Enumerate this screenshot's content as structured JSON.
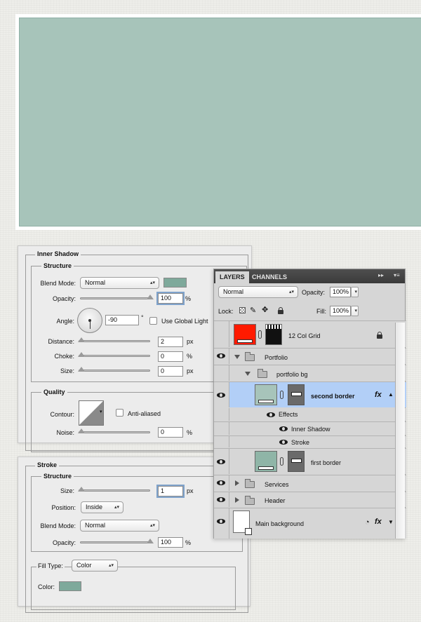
{
  "canvas": {
    "fill_color": "#a7c4ba"
  },
  "inner_shadow": {
    "title": "Inner Shadow",
    "structure_legend": "Structure",
    "blend_mode_label": "Blend Mode:",
    "blend_mode_value": "Normal",
    "color": "#7ea99b",
    "opacity_label": "Opacity:",
    "opacity_value": "100",
    "opacity_unit": "%",
    "angle_label": "Angle:",
    "angle_value": "-90",
    "degree_symbol": "°",
    "use_global_light_label": "Use Global Light",
    "distance_label": "Distance:",
    "distance_value": "2",
    "distance_unit": "px",
    "choke_label": "Choke:",
    "choke_value": "0",
    "choke_unit": "%",
    "size_label": "Size:",
    "size_value": "0",
    "size_unit": "px",
    "quality_legend": "Quality",
    "contour_label": "Contour:",
    "anti_aliased_label": "Anti-aliased",
    "noise_label": "Noise:",
    "noise_value": "0",
    "noise_unit": "%"
  },
  "stroke": {
    "title": "Stroke",
    "structure_legend": "Structure",
    "size_label": "Size:",
    "size_value": "1",
    "size_unit": "px",
    "position_label": "Position:",
    "position_value": "Inside",
    "blend_mode_label": "Blend Mode:",
    "blend_mode_value": "Normal",
    "opacity_label": "Opacity:",
    "opacity_value": "100",
    "opacity_unit": "%",
    "fill_type_label": "Fill Type:",
    "fill_type_value": "Color",
    "color_label": "Color:",
    "color": "#7ea99b"
  },
  "layers_panel": {
    "tab_layers": "LAYERS",
    "tab_channels": "CHANNELS",
    "blend_mode_value": "Normal",
    "opacity_label": "Opacity:",
    "opacity_value": "100%",
    "lock_label": "Lock:",
    "fill_label": "Fill:",
    "fill_value": "100%",
    "layers": {
      "grid": "12 Col Grid",
      "portfolio": "Portfolio",
      "portfolio_bg": "portfolio bg",
      "second_border": "second border",
      "effects": "Effects",
      "inner_shadow": "Inner Shadow",
      "stroke": "Stroke",
      "first_border": "first border",
      "services": "Services",
      "header": "Header",
      "main_background": "Main background"
    },
    "fx_label": "fx",
    "grid_thumb_color": "#ff1a00",
    "selected_color": "#b2cff7"
  }
}
